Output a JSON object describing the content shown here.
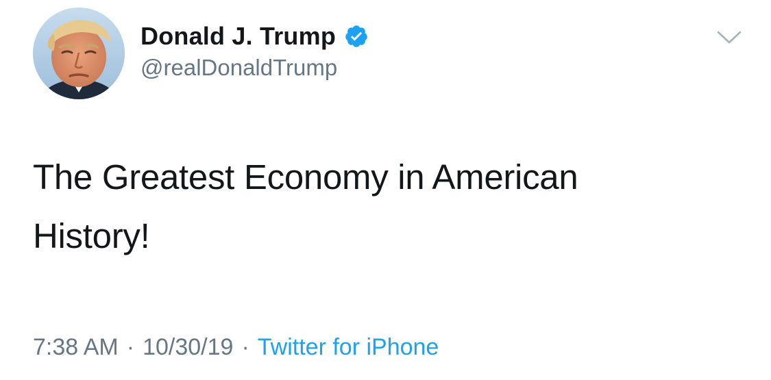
{
  "user": {
    "display_name": "Donald J. Trump",
    "handle": "@realDonaldTrump",
    "verified": true,
    "avatar_icon": "profile-photo",
    "verified_icon": "verified-badge-icon"
  },
  "tweet": {
    "text": "The Greatest Economy in American History!"
  },
  "meta": {
    "time": "7:38 AM",
    "separator": "·",
    "date": "10/30/19",
    "source": "Twitter for iPhone"
  },
  "menu": {
    "icon": "chevron-down-icon"
  },
  "colors": {
    "text": "#14171a",
    "secondary": "#657786",
    "accent": "#1da1f2",
    "background": "#ffffff"
  }
}
